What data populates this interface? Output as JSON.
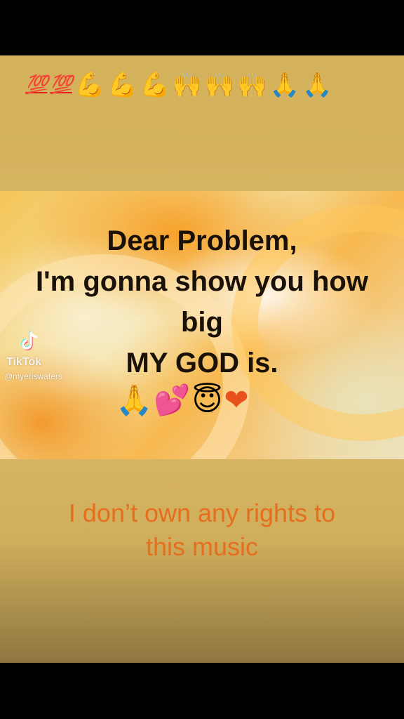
{
  "emoji_row": {
    "hundred_1": "💯",
    "hundred_2": "💯",
    "muscle": "💪",
    "raised_hands": "🙌",
    "pray": "🙏"
  },
  "headline": {
    "line1": "Dear Problem,",
    "line2": "I'm gonna show you how",
    "line3": "big",
    "line4": "MY GOD is."
  },
  "heart_row": {
    "pray": "🙏",
    "hearts": "💕",
    "smile_halo": "😇",
    "heart": "❤"
  },
  "watermark": {
    "app": "TikTok",
    "handle": "@myeriswaters"
  },
  "caption": {
    "line1": "I don’t own any rights to",
    "line2": "this music"
  },
  "colors": {
    "background": "#d7b662",
    "caption": "#e56f1e",
    "headline": "#1a1208"
  }
}
